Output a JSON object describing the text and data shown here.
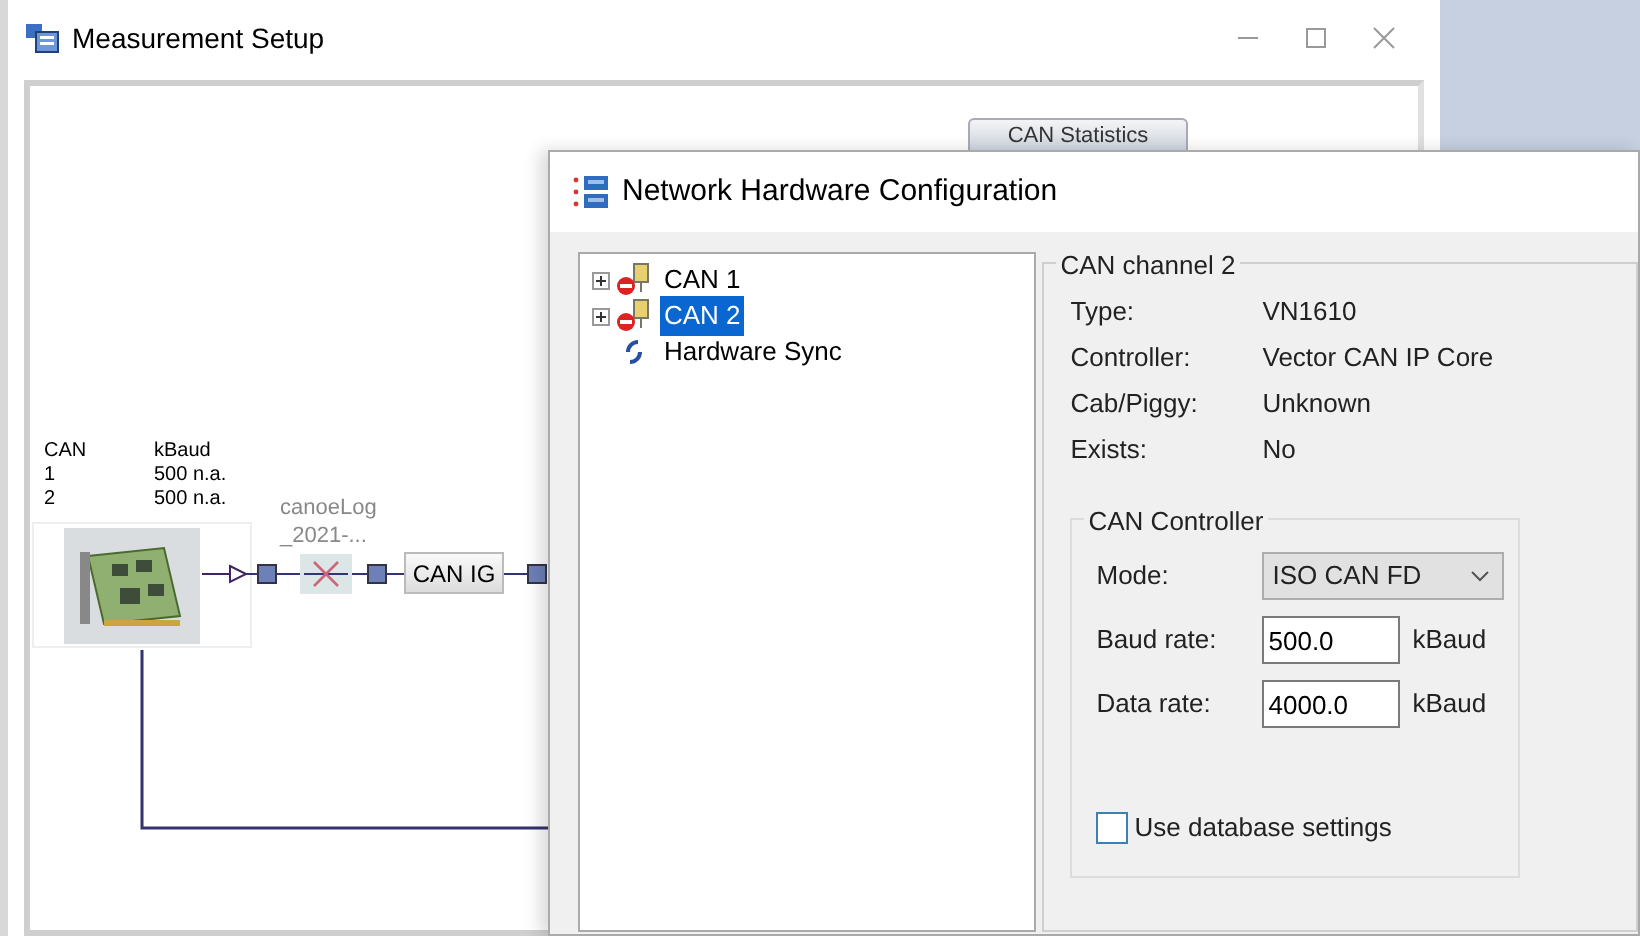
{
  "main_window": {
    "title": "Measurement Setup",
    "statistics_button": "CAN Statistics",
    "bus_table": {
      "columns": [
        "CAN",
        "kBaud"
      ],
      "rows": [
        [
          "1",
          "500 n.a."
        ],
        [
          "2",
          "500 n.a."
        ]
      ]
    },
    "log_block": {
      "lines": [
        "canoeLog",
        "_2021-..."
      ],
      "disabled": true
    },
    "ig_block": "CAN IG"
  },
  "dialog": {
    "title": "Network Hardware Configuration",
    "tree": [
      {
        "label": "CAN 1",
        "kind": "channel",
        "expanded": false,
        "selected": false
      },
      {
        "label": "CAN 2",
        "kind": "channel",
        "expanded": false,
        "selected": true
      },
      {
        "label": "Hardware Sync",
        "kind": "sync",
        "selected": false
      }
    ],
    "channel_group": {
      "title": "CAN channel 2",
      "fields": [
        {
          "label": "Type:",
          "value": "VN1610"
        },
        {
          "label": "Controller:",
          "value": "Vector CAN IP Core"
        },
        {
          "label": "Cab/Piggy:",
          "value": "Unknown"
        },
        {
          "label": "Exists:",
          "value": "No"
        }
      ]
    },
    "controller_group": {
      "title": "CAN Controller",
      "mode": {
        "label": "Mode:",
        "value": "ISO CAN FD"
      },
      "rates": [
        {
          "label": "Baud rate:",
          "value": "500.0",
          "unit": "kBaud"
        },
        {
          "label": "Data rate:",
          "value": "4000.0",
          "unit": "kBaud"
        }
      ],
      "database_checkbox": {
        "label": "Use database settings",
        "checked": false
      }
    }
  }
}
